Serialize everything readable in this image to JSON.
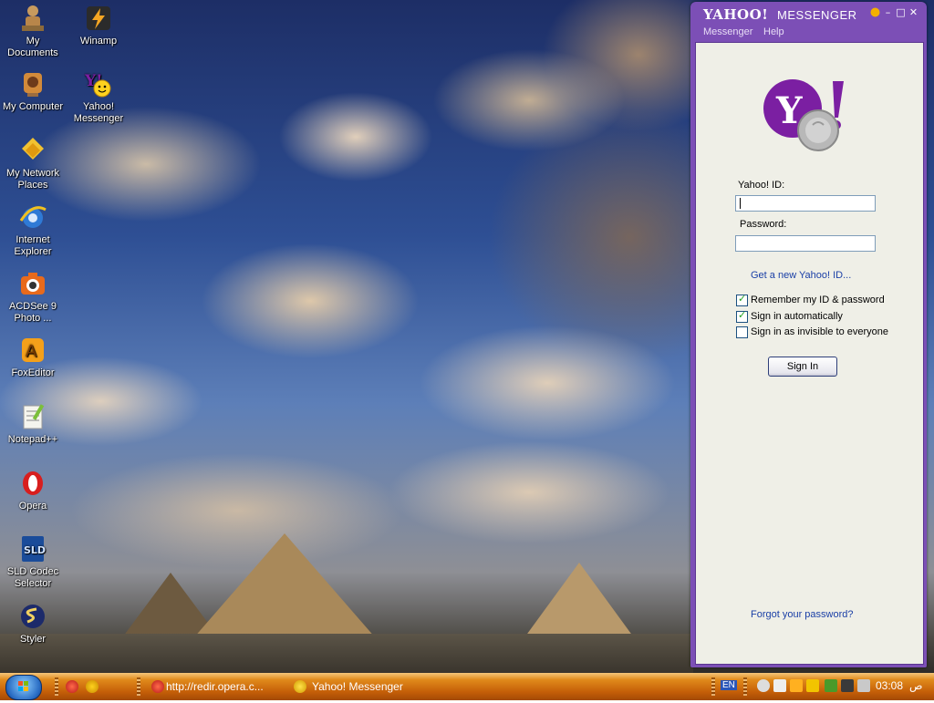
{
  "desktop": {
    "icons": [
      {
        "label": "My Documents"
      },
      {
        "label": "Winamp"
      },
      {
        "label": "My Computer"
      },
      {
        "label": "Yahoo! Messenger"
      },
      {
        "label": "My Network Places"
      },
      {
        "label": "Internet Explorer"
      },
      {
        "label": "ACDSee 9 Photo ..."
      },
      {
        "label": "FoxEditor"
      },
      {
        "label": "Notepad++"
      },
      {
        "label": "Opera"
      },
      {
        "label": "SLD Codec Selector"
      },
      {
        "label": "Styler"
      }
    ]
  },
  "messenger": {
    "title_brand": "YAHOO!",
    "title_product": "MESSENGER",
    "menu": [
      "Messenger",
      "Help"
    ],
    "yahoo_id_label": "Yahoo! ID:",
    "yahoo_id_value": "",
    "password_label": "Password:",
    "password_value": "",
    "get_new_id_link": "Get a new Yahoo! ID...",
    "options": [
      {
        "label": "Remember my ID & password",
        "checked": true
      },
      {
        "label": "Sign in automatically",
        "checked": true
      },
      {
        "label": "Sign in as invisible to everyone",
        "checked": false
      }
    ],
    "sign_in_label": "Sign In",
    "forgot_link": "Forgot your password?",
    "brand_color": "#7c4fb6"
  },
  "taskbar": {
    "tasks": [
      {
        "label": "http://redir.opera.c...",
        "icon": "opera-icon"
      },
      {
        "label": "Yahoo! Messenger",
        "icon": "yahoo-smiley-icon"
      }
    ],
    "language": "EN",
    "clock": "03:08",
    "clock_suffix": "ص"
  }
}
